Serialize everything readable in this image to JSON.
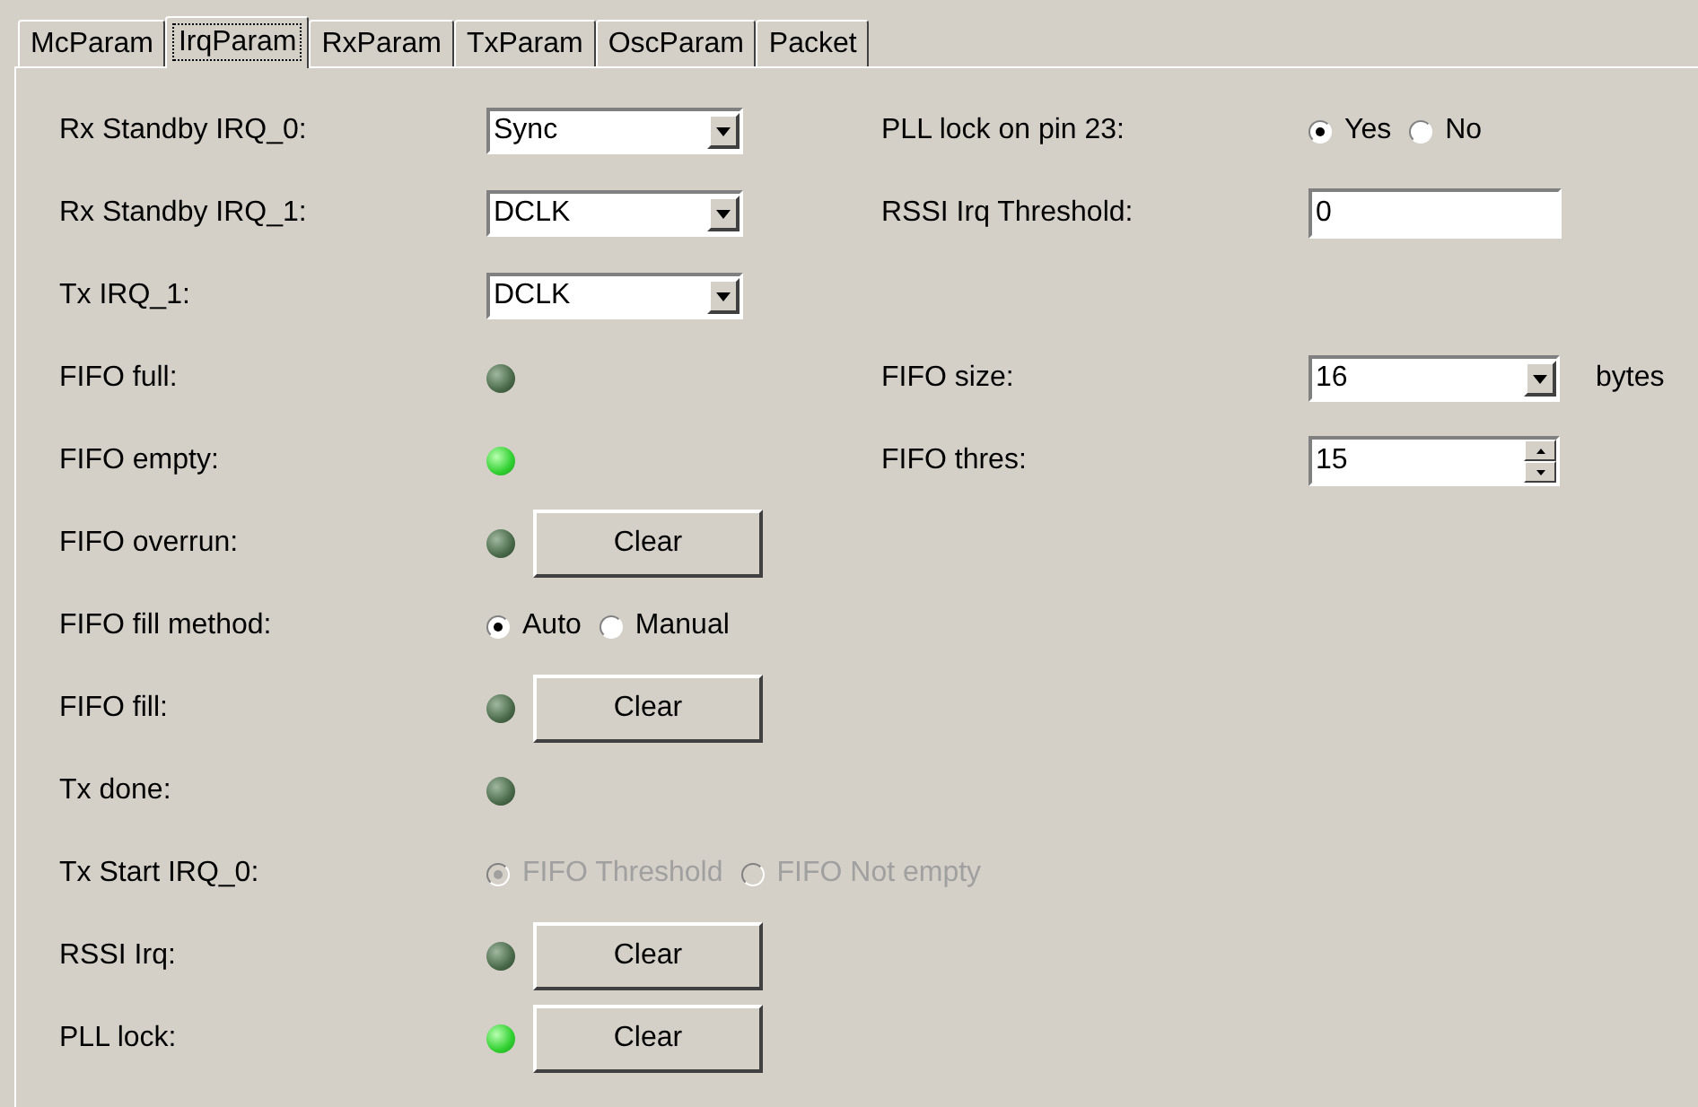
{
  "tabs": [
    {
      "label": "McParam",
      "selected": false
    },
    {
      "label": "IrqParam",
      "selected": true
    },
    {
      "label": "RxParam",
      "selected": false
    },
    {
      "label": "TxParam",
      "selected": false
    },
    {
      "label": "OscParam",
      "selected": false
    },
    {
      "label": "Packet",
      "selected": false
    }
  ],
  "left_rows": [
    {
      "kind": "dropdown",
      "label": "Rx Standby IRQ_0:",
      "value": "Sync"
    },
    {
      "kind": "dropdown",
      "label": "Rx Standby IRQ_1:",
      "value": "DCLK"
    },
    {
      "kind": "dropdown",
      "label": "Tx IRQ_1:",
      "value": "DCLK"
    },
    {
      "kind": "led",
      "label": "FIFO full:",
      "lit": false
    },
    {
      "kind": "led",
      "label": "FIFO empty:",
      "lit": true
    },
    {
      "kind": "led",
      "label": "FIFO overrun:",
      "lit": false,
      "button": "Clear"
    },
    {
      "kind": "radio",
      "label": "FIFO fill method:",
      "disabled": false,
      "options": [
        {
          "label": "Auto",
          "selected": true
        },
        {
          "label": "Manual",
          "selected": false
        }
      ]
    },
    {
      "kind": "led",
      "label": "FIFO fill:",
      "lit": false,
      "button": "Clear"
    },
    {
      "kind": "led",
      "label": "Tx done:",
      "lit": false
    },
    {
      "kind": "radio",
      "label": "Tx Start IRQ_0:",
      "disabled": true,
      "options": [
        {
          "label": "FIFO Threshold",
          "selected": true
        },
        {
          "label": "FIFO Not empty",
          "selected": false
        }
      ]
    },
    {
      "kind": "led",
      "label": "RSSI Irq:",
      "lit": false,
      "button": "Clear"
    },
    {
      "kind": "led",
      "label": "PLL lock:",
      "lit": true,
      "button": "Clear"
    }
  ],
  "pll_settings": [
    {
      "kind": "radio",
      "label": "PLL lock on pin 23:",
      "disabled": false,
      "options": [
        {
          "label": "Yes",
          "selected": true
        },
        {
          "label": "No",
          "selected": false
        }
      ]
    },
    {
      "kind": "text",
      "label": "RSSI Irq Threshold:",
      "value": "0"
    }
  ],
  "fifo_settings": [
    {
      "kind": "dropdown",
      "label": "FIFO size:",
      "value": "16",
      "unit": "bytes"
    },
    {
      "kind": "spinner",
      "label": "FIFO thres:",
      "value": "15"
    }
  ]
}
